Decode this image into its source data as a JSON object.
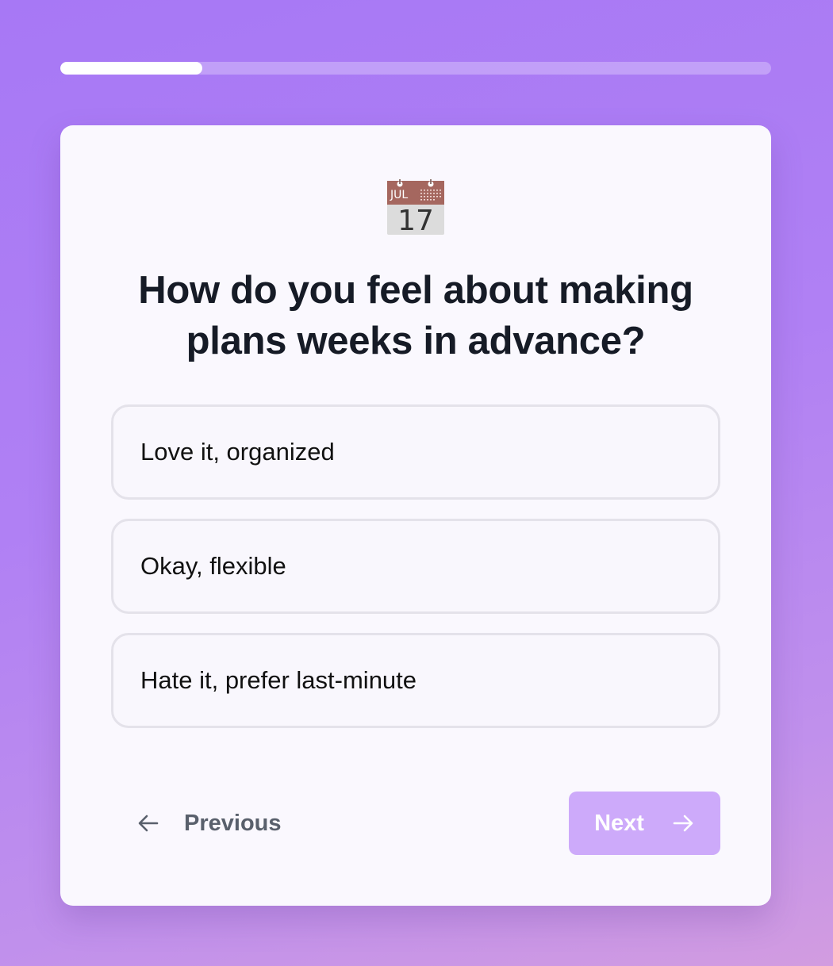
{
  "progress": {
    "fraction": 0.2,
    "fill_color": "#ffffff",
    "track_color": "rgba(255,255,255,0.28)"
  },
  "question": {
    "icon": "calendar-icon",
    "icon_month": "JUL",
    "icon_day": "17",
    "text": "How do you feel about making plans weeks in advance?"
  },
  "options": [
    {
      "label": "Love it, organized"
    },
    {
      "label": "Okay, flexible"
    },
    {
      "label": "Hate it, prefer last-minute"
    }
  ],
  "navigation": {
    "previous_label": "Previous",
    "previous_icon": "arrow-left-icon",
    "next_label": "Next",
    "next_icon": "arrow-right-icon",
    "next_button_color": "#cdaafa"
  },
  "colors": {
    "background_gradient_start": "#a778f5",
    "background_gradient_end": "#d29ce0",
    "card_background": "#faf8fe",
    "option_border": "#e4e2ea",
    "question_text": "#161b26",
    "previous_text": "#59606c"
  }
}
